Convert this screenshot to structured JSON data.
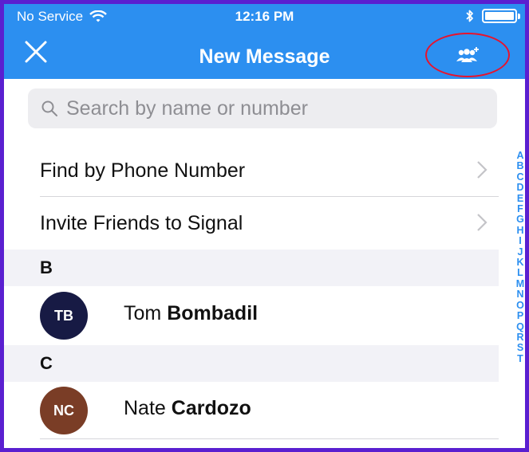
{
  "status_bar": {
    "carrier": "No Service",
    "time": "12:16 PM",
    "wifi_icon": "wifi-icon",
    "bluetooth_icon": "bluetooth-icon",
    "battery_icon": "battery-icon"
  },
  "nav": {
    "title": "New Message",
    "close_icon": "close-icon",
    "group_icon": "new-group-icon",
    "highlight_color": "#e8132c"
  },
  "search": {
    "placeholder": "Search by name or number",
    "value": ""
  },
  "actions": [
    {
      "label": "Find by Phone Number"
    },
    {
      "label": "Invite Friends to Signal"
    }
  ],
  "sections": [
    {
      "letter": "B",
      "contacts": [
        {
          "initials": "TB",
          "first": "Tom",
          "last": "Bombadil",
          "color": "#171a44"
        }
      ]
    },
    {
      "letter": "C",
      "contacts": [
        {
          "initials": "NC",
          "first": "Nate",
          "last": "Cardozo",
          "color": "#7a3d26"
        }
      ]
    }
  ],
  "index_letters": [
    "A",
    "B",
    "C",
    "D",
    "E",
    "F",
    "G",
    "H",
    "I",
    "J",
    "K",
    "L",
    "M",
    "N",
    "O",
    "P",
    "Q",
    "R",
    "S",
    "T"
  ],
  "colors": {
    "header": "#2c8ff0",
    "frame": "#5a1fd0",
    "index": "#2c8ff0"
  }
}
